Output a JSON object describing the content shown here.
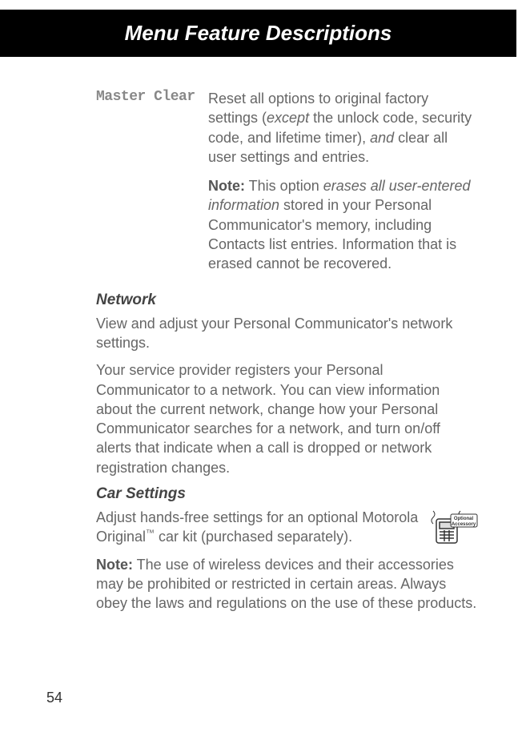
{
  "header": {
    "title": "Menu Feature Descriptions"
  },
  "masterClear": {
    "term": "Master Clear",
    "desc1_a": "Reset all options to original factory settings (",
    "desc1_b": "except",
    "desc1_c": " the unlock code, security code, and lifetime timer), ",
    "desc1_d": "and",
    "desc1_e": " clear all user settings and entries.",
    "note_label": "Note:",
    "note_a": " This option ",
    "note_b": "erases all user-entered information",
    "note_c": " stored in your Personal Communicator's memory, including Contacts list entries. Information that is erased cannot be recovered."
  },
  "network": {
    "heading": "Network",
    "p1": "View and adjust your Personal Communicator's network settings.",
    "p2": "Your service provider registers your Personal Communicator to a network. You can view information about the current network, change how your Personal Communicator searches for a network, and turn on/off alerts that indicate when a call is dropped or network registration changes."
  },
  "carSettings": {
    "heading": "Car Settings",
    "p1_a": "Adjust hands-free settings for an optional Motorola Original",
    "p1_tm": "™",
    "p1_b": " car kit (purchased separately).",
    "note_label": "Note:",
    "note_text": " The use of wireless devices and their accessories may be prohibited or restricted in certain areas. Always obey the laws and regulations on the use of these products.",
    "icon_label_a": "Optional",
    "icon_label_b": "Accessory"
  },
  "pageNumber": "54"
}
